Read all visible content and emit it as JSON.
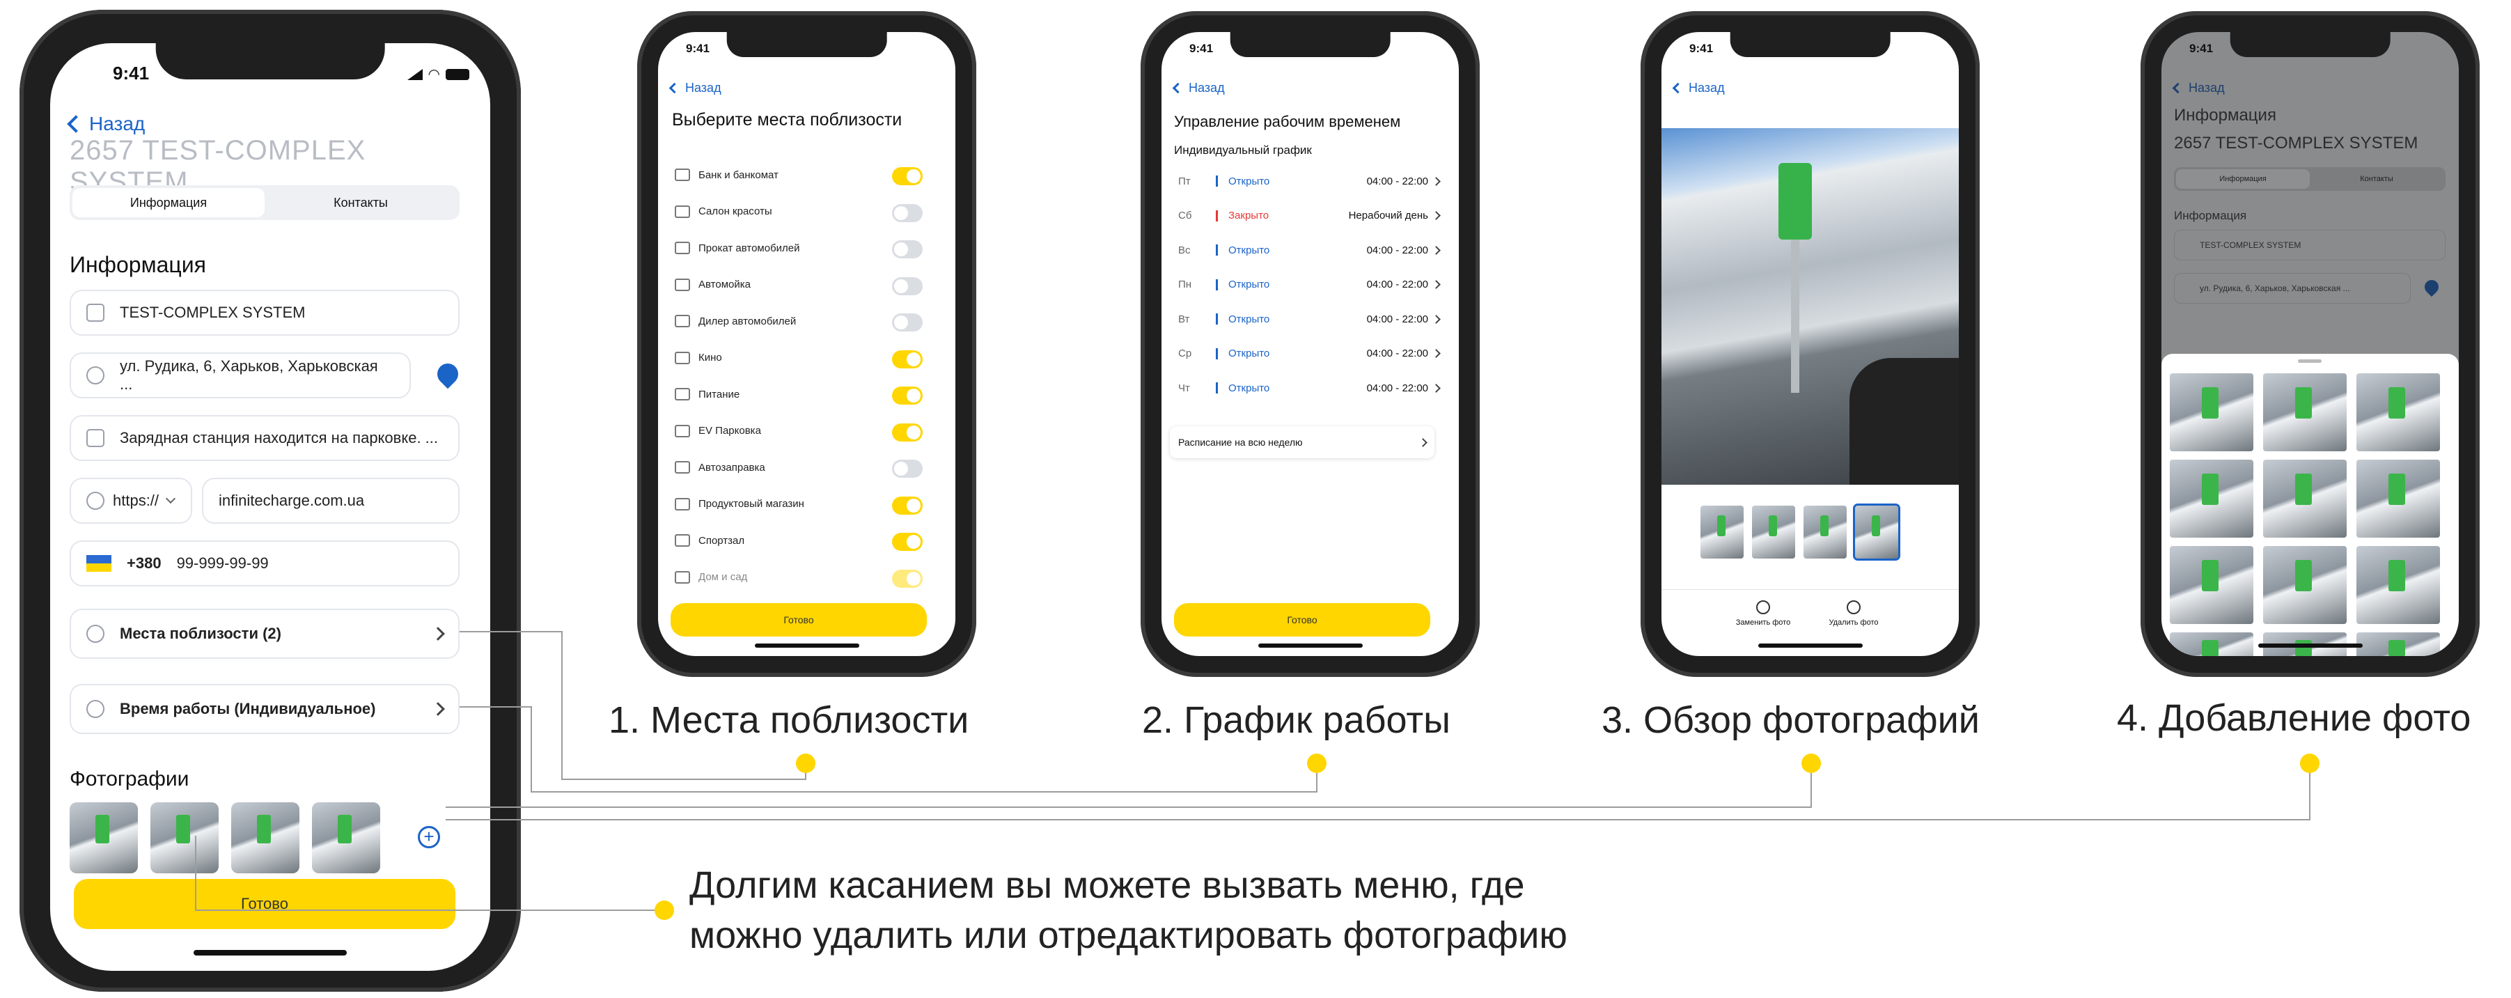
{
  "status_time": "9:41",
  "main": {
    "back": "Назад",
    "title": "2657 TEST-COMPLEX SYSTEM",
    "tabs": [
      "Информация",
      "Контакты"
    ],
    "section_info": "Информация",
    "name": "TEST-COMPLEX SYSTEM",
    "address": "ул. Рудика, 6, Харьков, Харьковская ...",
    "description": "Зарядная станция находится на парковке. ...",
    "protocol": "https://",
    "website": "infinitecharge.com.ua",
    "country_code": "+380",
    "phone": "99-999-99-99",
    "nearby": "Места поблизости (2)",
    "hours": "Время работы (Индивидуальное)",
    "photos_title": "Фотографии",
    "done": "Готово"
  },
  "nearby_screen": {
    "back": "Назад",
    "title": "Выберите места поблизости",
    "items": [
      {
        "label": "Банк и банкомат",
        "on": true
      },
      {
        "label": "Салон красоты",
        "on": false
      },
      {
        "label": "Прокат автомобилей",
        "on": false
      },
      {
        "label": "Автомойка",
        "on": false
      },
      {
        "label": "Дилер автомобилей",
        "on": false
      },
      {
        "label": "Кино",
        "on": true
      },
      {
        "label": "Питание",
        "on": true
      },
      {
        "label": "EV Парковка",
        "on": true
      },
      {
        "label": "Автозаправка",
        "on": false
      },
      {
        "label": "Продуктовый магазин",
        "on": true
      },
      {
        "label": "Спортзал",
        "on": true
      },
      {
        "label": "Дом и сад",
        "on": true
      }
    ],
    "done": "Готово"
  },
  "schedule_screen": {
    "back": "Назад",
    "title": "Управление рабочим временем",
    "subtitle": "Индивидуальный график",
    "rows": [
      {
        "day": "Пт",
        "status": "Открыто",
        "time": "04:00 - 22:00",
        "closed": false
      },
      {
        "day": "Сб",
        "status": "Закрыто",
        "time": "Нерабочий день",
        "closed": true
      },
      {
        "day": "Вс",
        "status": "Открыто",
        "time": "04:00 - 22:00",
        "closed": false
      },
      {
        "day": "Пн",
        "status": "Открыто",
        "time": "04:00 - 22:00",
        "closed": false
      },
      {
        "day": "Вт",
        "status": "Открыто",
        "time": "04:00 - 22:00",
        "closed": false
      },
      {
        "day": "Ср",
        "status": "Открыто",
        "time": "04:00 - 22:00",
        "closed": false
      },
      {
        "day": "Чт",
        "status": "Открыто",
        "time": "04:00 - 22:00",
        "closed": false
      }
    ],
    "week_schedule": "Расписание на всю неделю",
    "done": "Готово"
  },
  "photo_screen": {
    "back": "Назад",
    "replace": "Заменить фото",
    "delete": "Удалить фото"
  },
  "add_photo_screen": {
    "back": "Назад",
    "header": "Информация",
    "title": "2657 TEST-COMPLEX SYSTEM",
    "tabs": [
      "Информация",
      "Контакты"
    ],
    "section": "Информация",
    "name": "TEST-COMPLEX SYSTEM",
    "address": "ул. Рудика, 6, Харьков, Харьковская ..."
  },
  "captions": {
    "c1": "1. Места поблизости",
    "c2": "2. График работы",
    "c3": "3. Обзор фотографий",
    "c4": "4. Добавление фото",
    "long_press_1": "Долгим касанием вы можете вызвать меню, где",
    "long_press_2": "можно удалить или отредактировать фотографию"
  },
  "colors": {
    "accent": "#1a63c7",
    "yellow": "#ffd600",
    "closed": "#e53935"
  }
}
